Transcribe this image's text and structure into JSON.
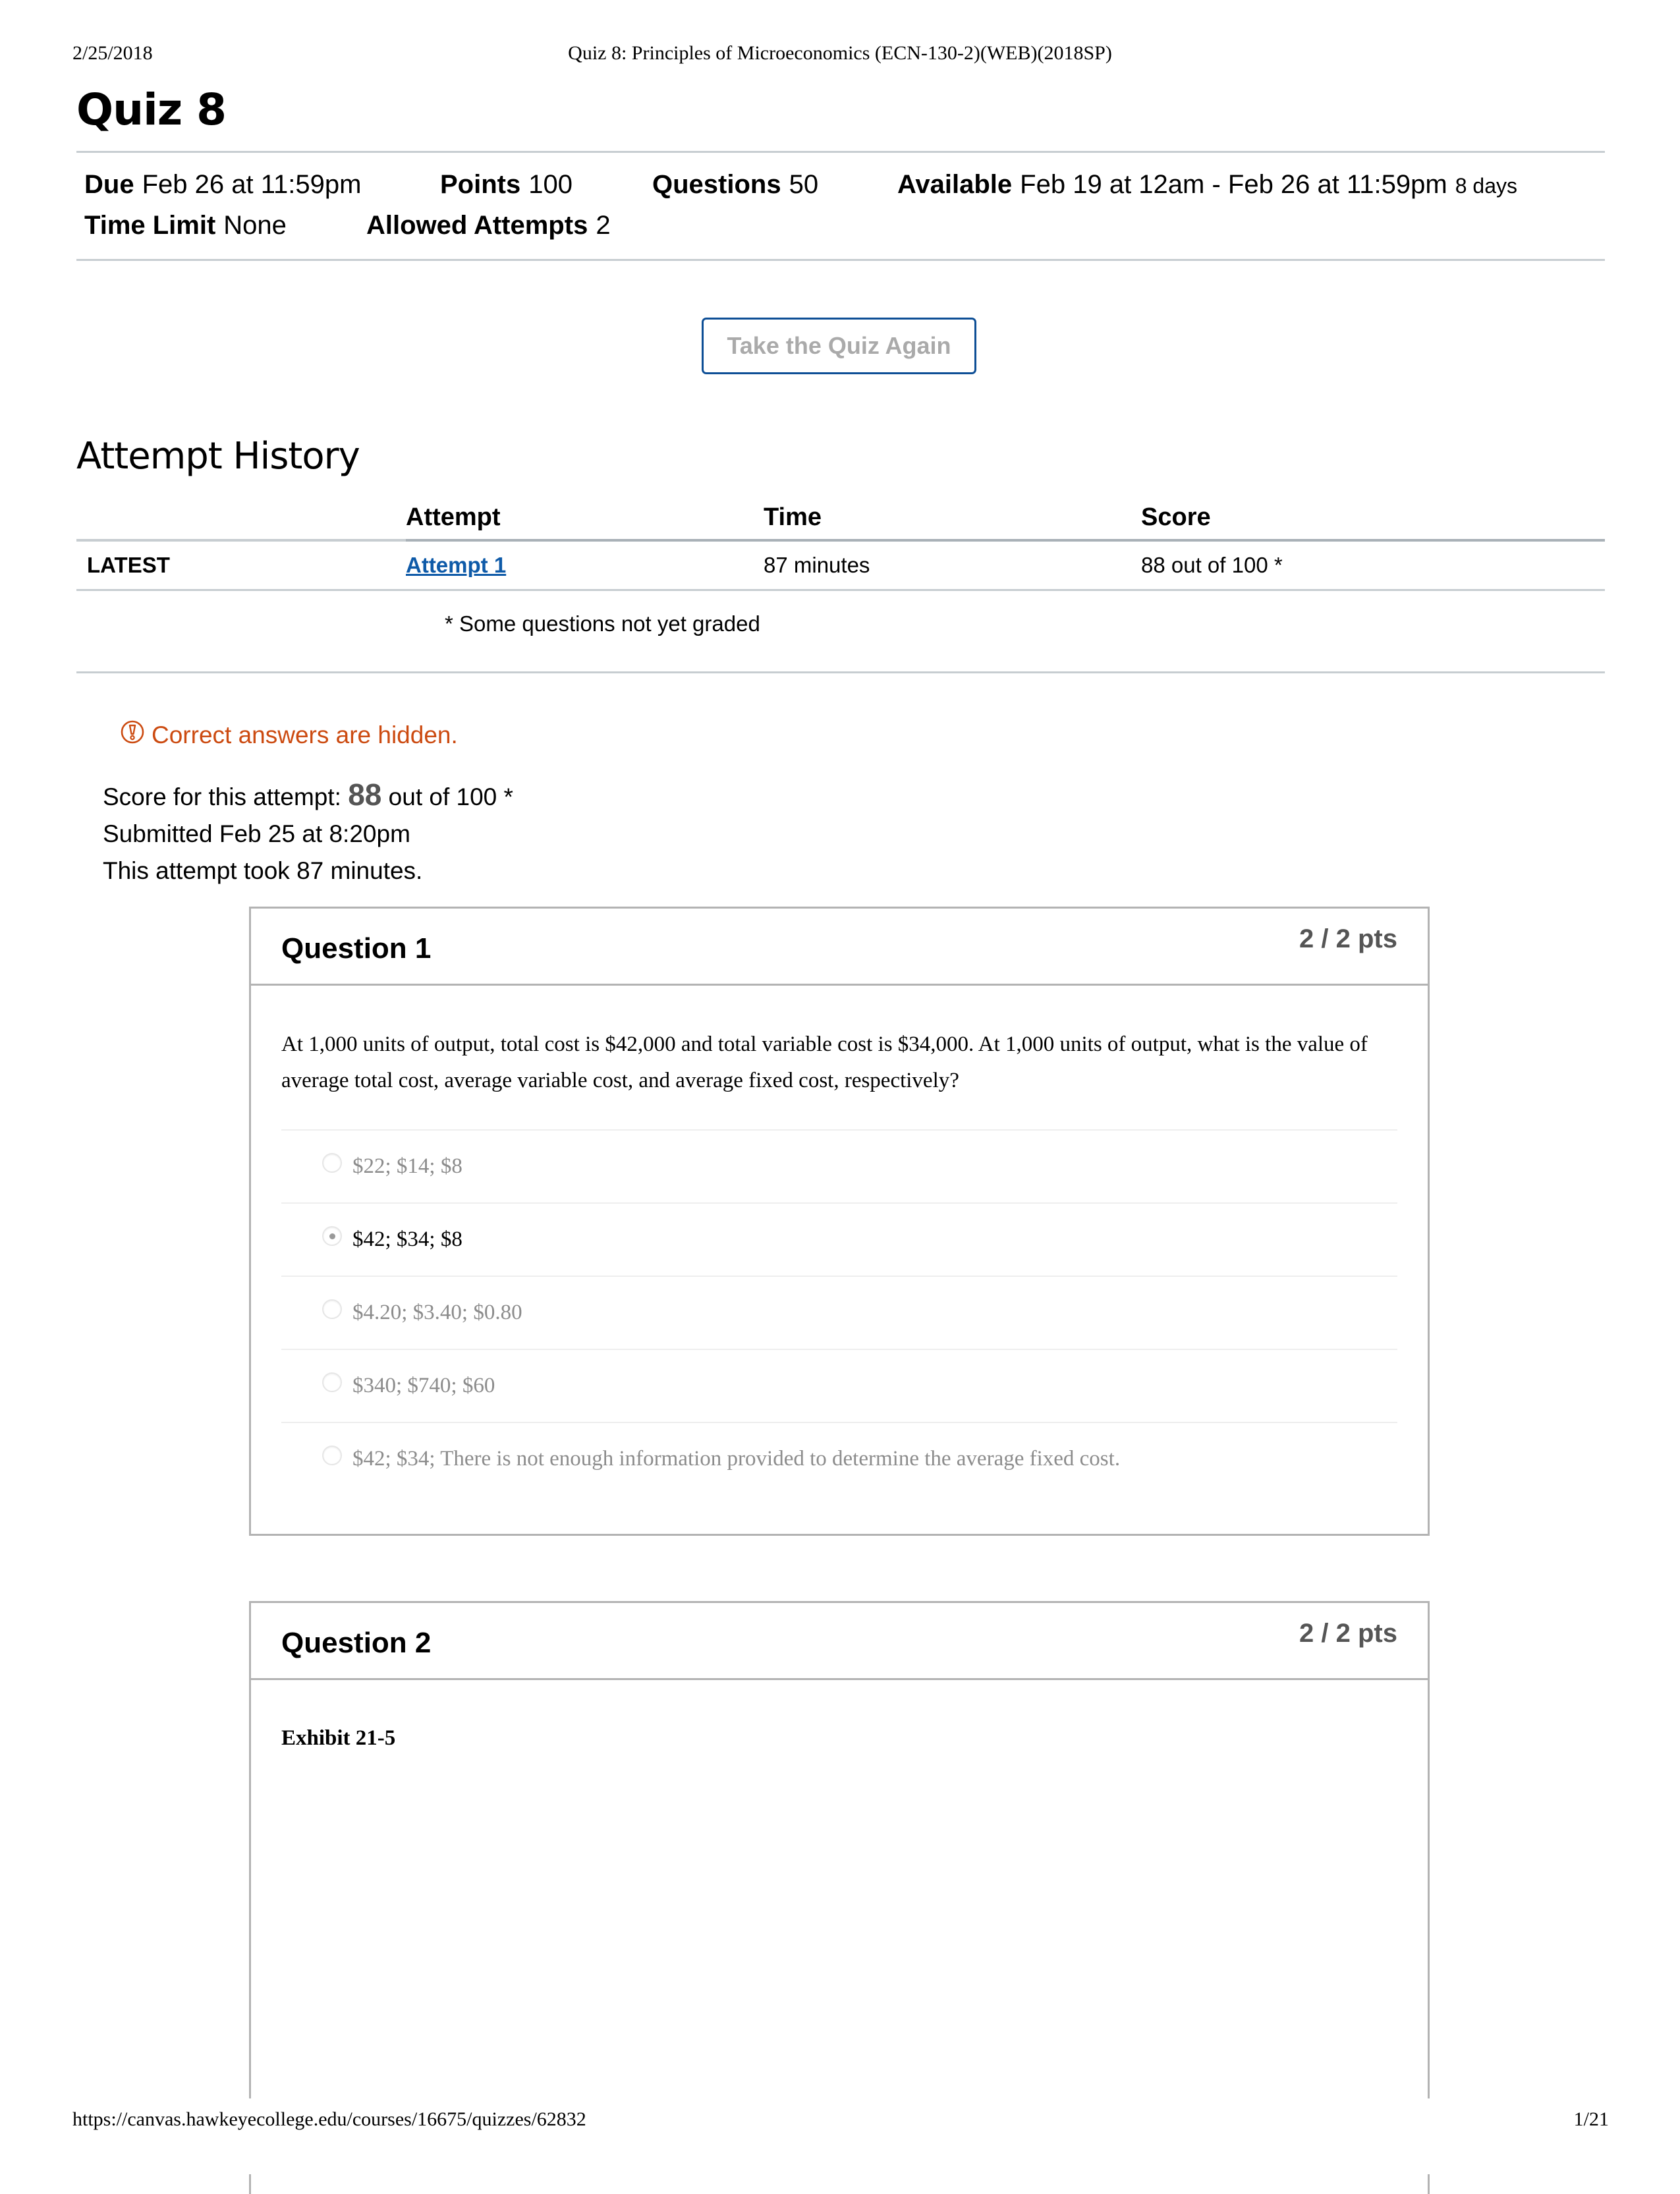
{
  "print_header": {
    "date": "2/25/2018",
    "title": "Quiz 8: Principles of Microeconomics (ECN-130-2)(WEB)(2018SP)"
  },
  "print_footer": {
    "url": "https://canvas.hawkeyecollege.edu/courses/16675/quizzes/62832",
    "page": "1/21"
  },
  "quiz": {
    "title": "Quiz 8",
    "details": {
      "due_label": "Due",
      "due_value": "Feb 26 at 11:59pm",
      "points_label": "Points",
      "points_value": "100",
      "questions_label": "Questions",
      "questions_value": "50",
      "available_label": "Available",
      "available_value": "Feb 19 at 12am - Feb 26 at 11:59pm",
      "available_duration": "8 days",
      "time_limit_label": "Time Limit",
      "time_limit_value": "None",
      "allowed_attempts_label": "Allowed Attempts",
      "allowed_attempts_value": "2"
    },
    "take_again_label": "Take the Quiz Again"
  },
  "attempt_history": {
    "heading": "Attempt History",
    "columns": [
      "",
      "Attempt",
      "Time",
      "Score"
    ],
    "rows": [
      {
        "tag": "LATEST",
        "attempt": "Attempt 1",
        "time": "87 minutes",
        "score": "88 out of 100 *"
      }
    ],
    "footnote": "* Some questions not yet graded"
  },
  "notice": {
    "icon": "warning-icon",
    "text": "Correct answers are hidden.",
    "color": "#cc4b11"
  },
  "attempt_summary": {
    "score_prefix": "Score for this attempt:",
    "score_value": "88",
    "score_suffix": "out of 100 *",
    "submitted": "Submitted Feb 25 at 8:20pm",
    "duration": "This attempt took 87 minutes."
  },
  "questions": [
    {
      "title": "Question 1",
      "points": "2 / 2 pts",
      "text": "At 1,000 units of output, total cost is $42,000 and total variable cost is $34,000. At 1,000 units of output, what is the value of average total cost, average variable cost, and average fixed cost, respectively?",
      "answers": [
        {
          "label": "$22; $14; $8",
          "selected": false
        },
        {
          "label": "$42; $34; $8",
          "selected": true
        },
        {
          "label": "$4.20; $3.40; $0.80",
          "selected": false
        },
        {
          "label": "$340; $740; $60",
          "selected": false
        },
        {
          "label": "$42; $34; There is not enough information provided to determine the average fixed cost.",
          "selected": false
        }
      ]
    },
    {
      "title": "Question 2",
      "points": "2 / 2 pts",
      "exhibit": "Exhibit 21-5"
    }
  ],
  "colors": {
    "link": "#0e5aa8",
    "button_border": "#0e4f96",
    "warning": "#cc4b11"
  }
}
